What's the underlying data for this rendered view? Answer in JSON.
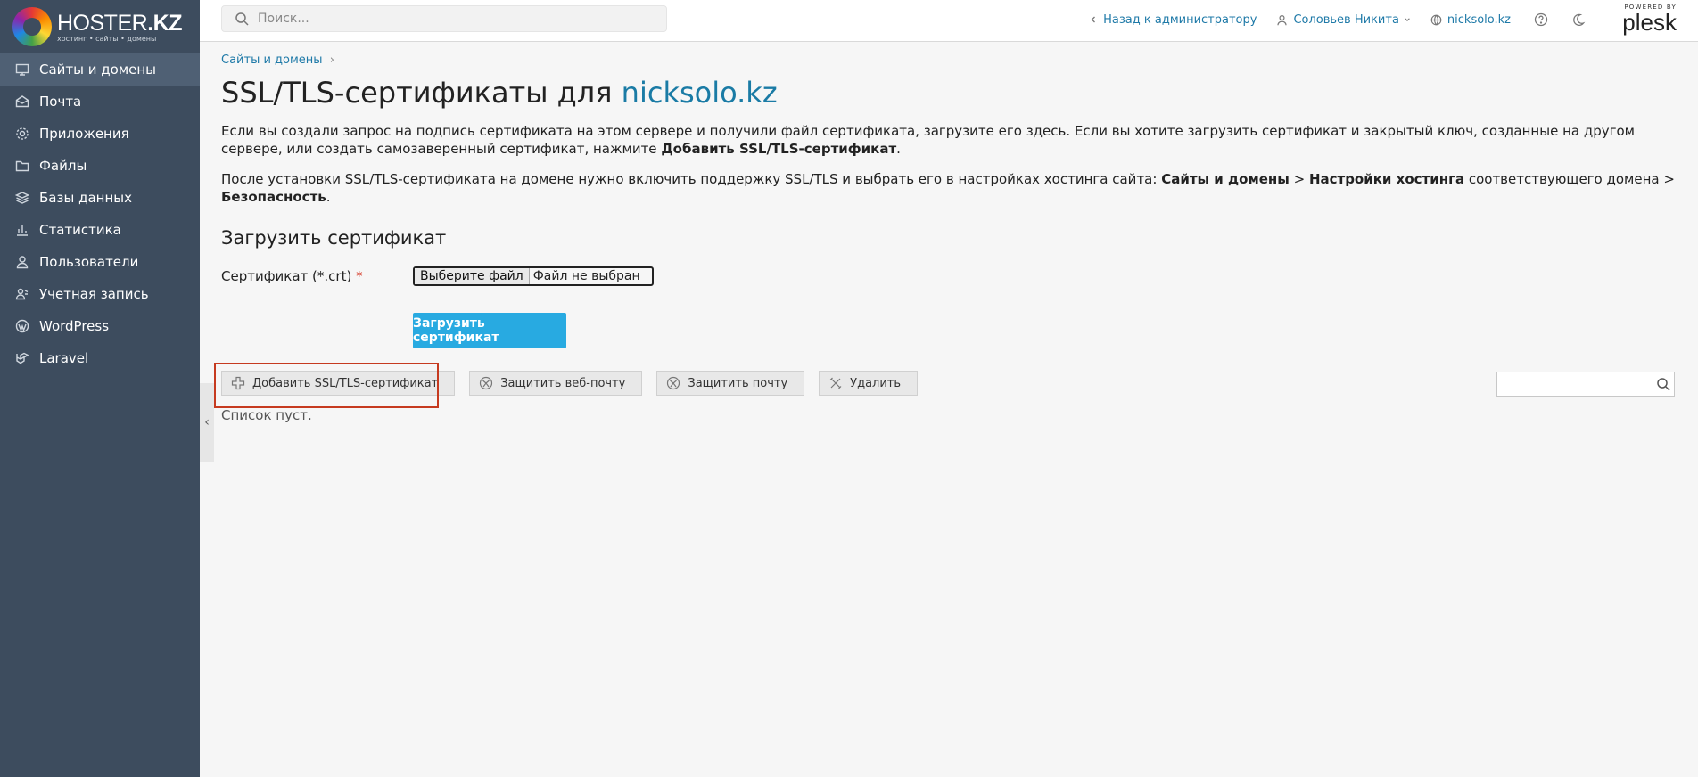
{
  "brand": {
    "logo_name": "HOSTER",
    "logo_tld": ".KZ",
    "logo_tagline": "хостинг • сайты • домены",
    "powered_by": "POWERED BY",
    "plesk": "plesk"
  },
  "sidebar": {
    "items": [
      {
        "label": "Сайты и домены",
        "icon": "monitor-icon"
      },
      {
        "label": "Почта",
        "icon": "mail-icon"
      },
      {
        "label": "Приложения",
        "icon": "gear-icon"
      },
      {
        "label": "Файлы",
        "icon": "folder-icon"
      },
      {
        "label": "Базы данных",
        "icon": "database-icon"
      },
      {
        "label": "Статистика",
        "icon": "bar-chart-icon"
      },
      {
        "label": "Пользователи",
        "icon": "user-icon"
      },
      {
        "label": "Учетная запись",
        "icon": "account-icon"
      },
      {
        "label": "WordPress",
        "icon": "wordpress-icon"
      },
      {
        "label": "Laravel",
        "icon": "laravel-icon"
      }
    ]
  },
  "topbar": {
    "search_placeholder": "Поиск...",
    "back_link": "Назад к администратору",
    "user": "Соловьев Никита",
    "domain": "nicksolo.kz"
  },
  "page": {
    "breadcrumb": "Сайты и домены",
    "title_prefix": "SSL/TLS-сертификаты для ",
    "title_domain": "nicksolo.kz",
    "para1_text": "Если вы создали запрос на подпись сертификата на этом сервере и получили файл сертификата, загрузите его здесь. Если вы хотите загрузить сертификат и закрытый ключ, созданные на другом сервере, или создать самозаверенный сертификат, нажмите ",
    "para1_bold": "Добавить SSL/TLS-сертификат",
    "para1_end": ".",
    "para2_text": "После установки SSL/TLS-сертификата на домене нужно включить поддержку SSL/TLS и выбрать его в настройках хостинга сайта: ",
    "para2_b1": "Сайты и домены",
    "para2_sep1": " > ",
    "para2_b2": "Настройки хостинга",
    "para2_mid": " соответствующего домена > ",
    "para2_b3": "Безопасность",
    "para2_end": ".",
    "upload_heading": "Загрузить сертификат",
    "cert_label": "Сертификат (*.crt)",
    "required_mark": "*",
    "file_button": "Выберите файл",
    "file_status": "Файл не выбран",
    "upload_button": "Загрузить сертификат"
  },
  "toolbar": {
    "add": "Добавить SSL/TLS-сертификат",
    "secure_webmail": "Защитить веб-почту",
    "secure_mail": "Защитить почту",
    "delete": "Удалить",
    "highlight_color": "#c63a1f"
  },
  "list": {
    "empty": "Список пуст."
  }
}
